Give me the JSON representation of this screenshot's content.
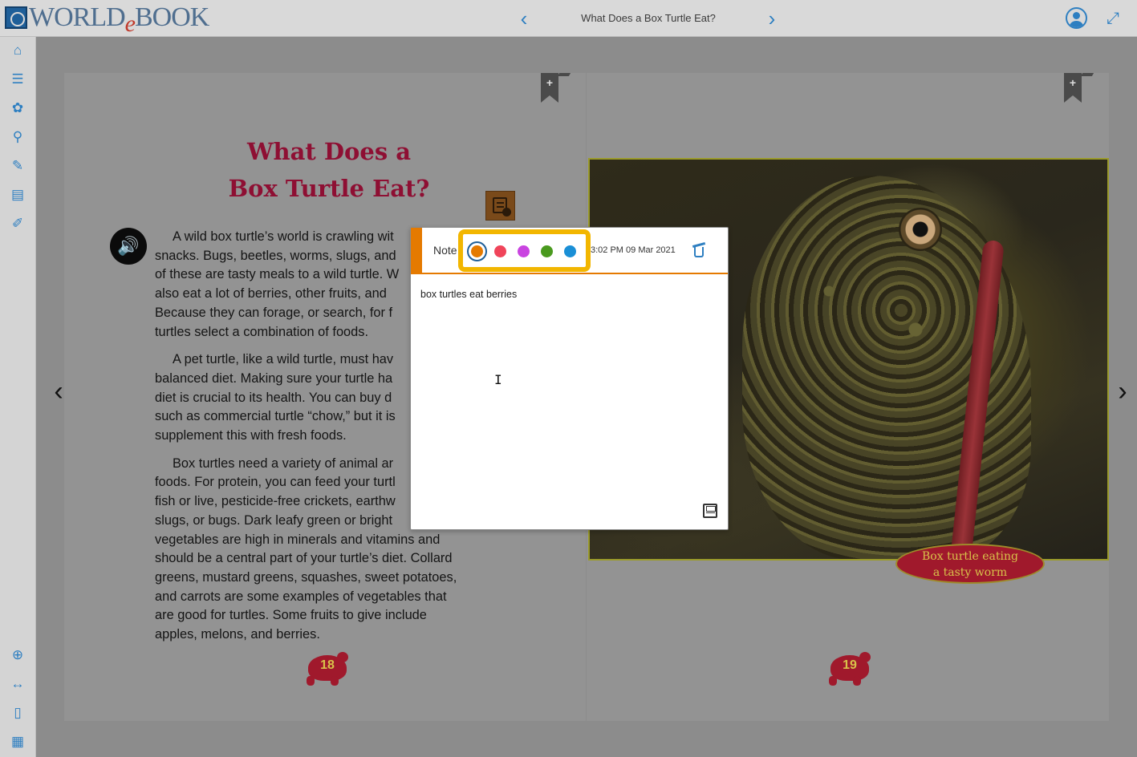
{
  "header": {
    "logo_text_1": "WORLD",
    "logo_text_e": "e",
    "logo_text_2": "BOOK",
    "book_title": "What Does a Box Turtle Eat?",
    "prev_glyph": "‹",
    "next_glyph": "›"
  },
  "sidebar": {
    "items": [
      {
        "name": "home",
        "glyph": "⌂"
      },
      {
        "name": "table-of-contents",
        "glyph": "☰"
      },
      {
        "name": "activities",
        "glyph": "✿"
      },
      {
        "name": "search",
        "glyph": "⚲"
      },
      {
        "name": "annotate",
        "glyph": "✎"
      },
      {
        "name": "notes",
        "glyph": "▤"
      },
      {
        "name": "highlighter",
        "glyph": "✐"
      }
    ],
    "bottom_items": [
      {
        "name": "zoom-in",
        "glyph": "⊕"
      },
      {
        "name": "fit-width",
        "glyph": "↔"
      },
      {
        "name": "single-page",
        "glyph": "▯"
      },
      {
        "name": "thumbnails",
        "glyph": "▦"
      }
    ]
  },
  "left_page": {
    "title": "What Does a\nBox Turtle Eat?",
    "paragraphs": [
      "A wild box turtle’s world is crawling wit\nsnacks. Bugs, beetles, worms, slugs, and\nof these are tasty meals to a wild turtle. W\nalso eat a lot of berries, other fruits, and\nBecause they can forage, or search, for f\nturtles select a combination of foods.",
      "A pet turtle, like a wild turtle, must hav\nbalanced diet. Making sure your turtle ha\ndiet is crucial to its health. You can buy d\nsuch as commercial turtle “chow,” but it is\nsupplement this with fresh foods.",
      "Box turtles need a variety of animal ar\nfoods. For protein, you can feed your turtl\nfish or live, pesticide-free crickets, earthw\nslugs, or bugs. Dark leafy green or bright\nvegetables are high in minerals and vitamins and\nshould be a central part of your turtle’s diet. Collard\ngreens, mustard greens, squashes, sweet potatoes,\nand carrots are some examples of vegetables that\nare good for turtles. Some fruits to give include\napples, melons, and berries."
    ],
    "page_number": "18"
  },
  "right_page": {
    "caption_line1": "Box turtle eating",
    "caption_line2": "a tasty worm",
    "page_number": "19"
  },
  "bookmark_glyph": "+",
  "note": {
    "label": "Note",
    "date": "3:02 PM 09 Mar 2021",
    "text": "box turtles eat berries",
    "colors": [
      {
        "name": "orange",
        "hex": "#e57a00",
        "selected": true
      },
      {
        "name": "red",
        "hex": "#f0445a",
        "selected": false
      },
      {
        "name": "purple",
        "hex": "#c944e0",
        "selected": false
      },
      {
        "name": "green",
        "hex": "#4a9a1e",
        "selected": false
      },
      {
        "name": "blue",
        "hex": "#1a8fd6",
        "selected": false
      }
    ],
    "highlight_border": "#f2b600"
  },
  "colors": {
    "accent": "#2e7fc1",
    "title": "#8e0f33",
    "turtle_badge": "#a0192c"
  }
}
